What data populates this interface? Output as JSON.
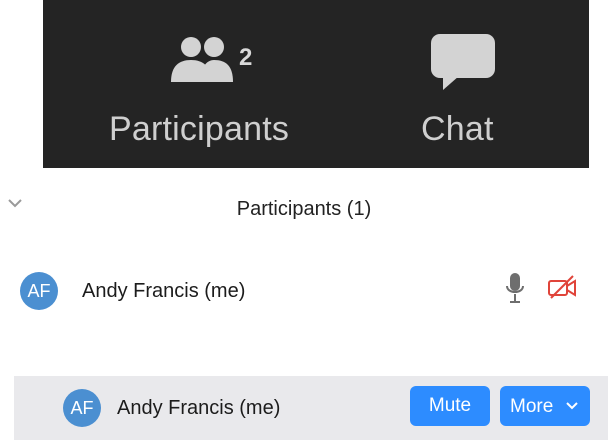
{
  "toolbar": {
    "participants": {
      "label": "Participants",
      "count": "2",
      "icon": "people-icon"
    },
    "chat": {
      "label": "Chat",
      "icon": "chat-icon"
    }
  },
  "panel": {
    "title": "Participants (1)",
    "collapse_icon": "chevron-down-icon"
  },
  "rows": [
    {
      "avatar": "AF",
      "name": "Andy Francis (me)",
      "icons": [
        "microphone-icon",
        "video-off-icon"
      ]
    },
    {
      "avatar": "AF",
      "name": "Andy Francis (me)",
      "buttons": {
        "mute": "Mute",
        "more": "More"
      },
      "hovered": true
    }
  ],
  "colors": {
    "toolbar_bg": "#242424",
    "avatar": "#4b8fd1",
    "button": "#2d8cff",
    "video_off": "#e0443a",
    "hover_row": "#e9e9ec"
  }
}
